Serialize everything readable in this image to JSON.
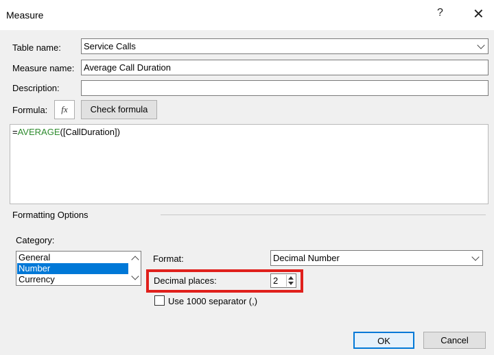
{
  "window": {
    "title": "Measure",
    "help_glyph": "?",
    "close_glyph": "✕"
  },
  "table_name": {
    "label": "Table name:",
    "value": "Service Calls"
  },
  "measure_name": {
    "label": "Measure name:",
    "value": "Average Call Duration"
  },
  "description": {
    "label": "Description:",
    "value": ""
  },
  "formula": {
    "label": "Formula:",
    "fx_glyph": "fx",
    "check_button": "Check formula",
    "prefix": "=",
    "function": "AVERAGE",
    "args": "([CallDuration])"
  },
  "formatting": {
    "section_title": "Formatting Options",
    "category_label": "Category:",
    "categories": [
      "General",
      "Number",
      "Currency"
    ],
    "selected_category": "Number",
    "format_label": "Format:",
    "format_value": "Decimal Number",
    "decimal_places_label": "Decimal places:",
    "decimal_places_value": "2",
    "separator_label": "Use 1000 separator (,)",
    "separator_checked": false
  },
  "buttons": {
    "ok": "OK",
    "cancel": "Cancel"
  },
  "colors": {
    "highlight_box": "#e0201c",
    "selection": "#0078d7",
    "formula_function": "#2e8b2e"
  }
}
